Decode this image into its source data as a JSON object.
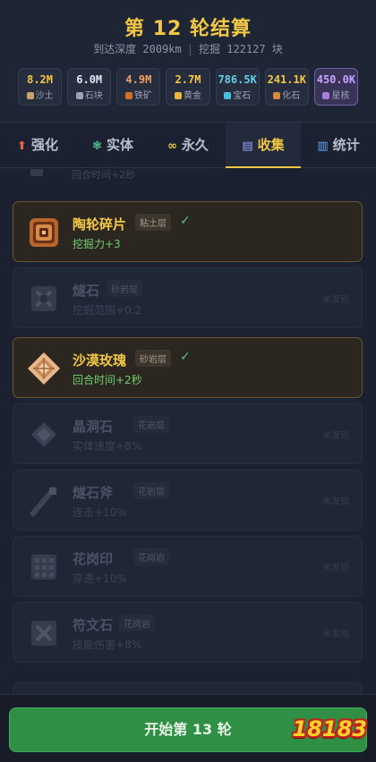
{
  "header": {
    "title": "第 12 轮结算",
    "depth_label": "到达深度 2009km",
    "separator": "|",
    "mined_label": "挖掘 122127 块"
  },
  "resources": [
    {
      "value": "8.2M",
      "label": "沙土",
      "color": "#f2c744",
      "dot": "#c9a46a"
    },
    {
      "value": "6.0M",
      "label": "石块",
      "color": "#e2e6ee",
      "dot": "#9aa2b3"
    },
    {
      "value": "4.9M",
      "label": "铁矿",
      "color": "#f0a060",
      "dot": "#d0722e"
    },
    {
      "value": "2.7M",
      "label": "黄金",
      "color": "#f2c744",
      "dot": "#e6b93a"
    },
    {
      "value": "786.5K",
      "label": "宝石",
      "color": "#63d0e8",
      "dot": "#4ac0e0"
    },
    {
      "value": "241.1K",
      "label": "化石",
      "color": "#f2c744",
      "dot": "#d68a3a"
    },
    {
      "value": "450.0K",
      "label": "星核",
      "color": "#c7a5ff",
      "dot": "#a57de0"
    }
  ],
  "tabs": [
    {
      "icon": "⬆",
      "label": "强化",
      "icon_color": "#e0604a"
    },
    {
      "icon": "❃",
      "label": "实体",
      "icon_color": "#4fc38a"
    },
    {
      "icon": "∞",
      "label": "永久",
      "icon_color": "#f2c744"
    },
    {
      "icon": "▤",
      "label": "收集",
      "icon_color": "#9aa7ff"
    },
    {
      "icon": "▥",
      "label": "统计",
      "icon_color": "#6aa6ff"
    }
  ],
  "partial_top_text": "回合时间+2秒",
  "items": [
    {
      "name": "陶轮碎片",
      "layer": "粘土层",
      "effect": "挖掘力+3",
      "collected": true,
      "check": "✓",
      "icon": "ring-icon"
    },
    {
      "name": "燧石",
      "layer": "砂岩层",
      "effect": "挖掘范围+0.2",
      "collected": false,
      "status": "未发现",
      "icon": "flint-icon"
    },
    {
      "name": "沙漠玫瑰",
      "layer": "砂岩层",
      "effect": "回合时间+2秒",
      "collected": true,
      "check": "✓",
      "icon": "rose-icon"
    },
    {
      "name": "晶洞石",
      "layer": "花岩层",
      "effect": "实体速度+8%",
      "collected": false,
      "status": "未发现",
      "icon": "geode-icon"
    },
    {
      "name": "燧石斧",
      "layer": "花岩层",
      "effect": "连击+10%",
      "collected": false,
      "status": "未发现",
      "icon": "axe-icon"
    },
    {
      "name": "花岗印",
      "layer": "花岗岩",
      "effect": "穿透+10%",
      "collected": false,
      "status": "未发现",
      "icon": "seal-icon"
    },
    {
      "name": "符文石",
      "layer": "花岗岩",
      "effect": "技能伤害+8%",
      "collected": false,
      "status": "未发现",
      "icon": "rune-icon"
    }
  ],
  "start_button": "开始第 13 轮",
  "logo_text": "18183"
}
